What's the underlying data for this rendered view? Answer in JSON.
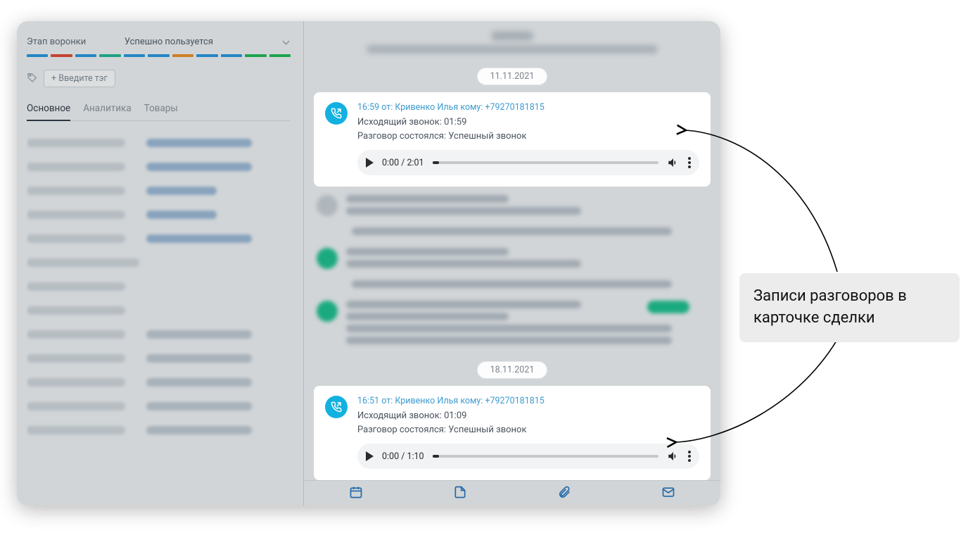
{
  "left": {
    "funnel_label": "Этап воронки",
    "funnel_stage": "Успешно пользуется",
    "tag_placeholder": "+  Введите тэг",
    "tabs": {
      "main": "Основное",
      "analytics": "Аналитика",
      "goods": "Товары"
    },
    "funnel_colors": [
      "#1f93e0",
      "#e0462a",
      "#1f93e0",
      "#17b890",
      "#1f93e0",
      "#1f93e0",
      "#ee8c1a",
      "#1f93e0",
      "#1f93e0",
      "#17b84e",
      "#17b84e"
    ]
  },
  "timeline": {
    "date1": "11.11.2021",
    "call1": {
      "header": "16:59 от: Кривенко Илья кому: +79270181815",
      "line1": "Исходящий звонок: 01:59",
      "line2": "Разговор состоялся: Успешный звонок",
      "time": "0:00 / 2:01"
    },
    "date2": "18.11.2021",
    "call2": {
      "header": "16:51 от: Кривенко Илья кому: +79270181815",
      "line1": "Исходящий звонок: 01:09",
      "line2": "Разговор состоялся: Успешный звонок",
      "time": "0:00 / 1:10"
    }
  },
  "annotation": "Записи разговоров в карточке сделки",
  "icons": {
    "phone_out": "phone-outgoing-icon",
    "volume": "volume-icon",
    "more": "more-vertical-icon",
    "tag": "tag-icon",
    "calendar": "calendar-icon",
    "note": "note-icon",
    "attach": "paperclip-icon",
    "mail": "mail-icon"
  }
}
